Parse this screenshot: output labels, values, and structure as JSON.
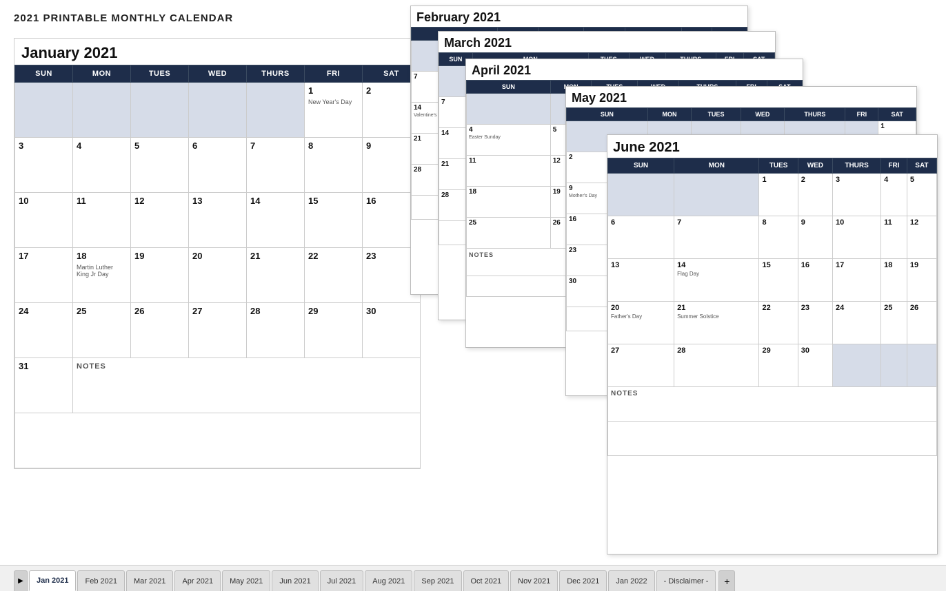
{
  "page": {
    "title": "2021 PRINTABLE MONTHLY CALENDAR"
  },
  "january": {
    "title": "January 2021",
    "headers": [
      "SUN",
      "MON",
      "TUES",
      "WED",
      "THURS",
      "FRI",
      "SAT"
    ],
    "weeks": [
      [
        {
          "day": "",
          "empty": true
        },
        {
          "day": "",
          "empty": true
        },
        {
          "day": "",
          "empty": true
        },
        {
          "day": "",
          "empty": true
        },
        {
          "day": "",
          "empty": true
        },
        {
          "day": "1",
          "holiday": "New Year's Day"
        },
        {
          "day": "2"
        }
      ],
      [
        {
          "day": "3"
        },
        {
          "day": "4"
        },
        {
          "day": "5"
        },
        {
          "day": "6"
        },
        {
          "day": "7"
        },
        {
          "day": "8"
        },
        {
          "day": "9"
        }
      ],
      [
        {
          "day": "10"
        },
        {
          "day": "11"
        },
        {
          "day": "12"
        },
        {
          "day": "13"
        },
        {
          "day": "14"
        },
        {
          "day": "15"
        },
        {
          "day": "16"
        }
      ],
      [
        {
          "day": "17"
        },
        {
          "day": "18",
          "holiday": "Martin Luther King Jr Day"
        },
        {
          "day": "19"
        },
        {
          "day": "20"
        },
        {
          "day": "21"
        },
        {
          "day": "22"
        },
        {
          "day": "23"
        }
      ],
      [
        {
          "day": "24"
        },
        {
          "day": "25"
        },
        {
          "day": "26"
        },
        {
          "day": "27"
        },
        {
          "day": "28"
        },
        {
          "day": "29"
        },
        {
          "day": "30"
        }
      ],
      [
        {
          "day": "31"
        },
        {
          "notes": "NOTES",
          "colspan": 6
        }
      ]
    ]
  },
  "tabs": [
    {
      "label": "Jan 2021",
      "active": true
    },
    {
      "label": "Feb 2021"
    },
    {
      "label": "Mar 2021"
    },
    {
      "label": "Apr 2021"
    },
    {
      "label": "May 2021"
    },
    {
      "label": "Jun 2021"
    },
    {
      "label": "Jul 2021"
    },
    {
      "label": "Aug 2021"
    },
    {
      "label": "Sep 2021"
    },
    {
      "label": "Oct 2021"
    },
    {
      "label": "Nov 2021"
    },
    {
      "label": "Dec 2021"
    },
    {
      "label": "Jan 2022"
    },
    {
      "label": "- Disclaimer -"
    },
    {
      "label": "+"
    }
  ]
}
